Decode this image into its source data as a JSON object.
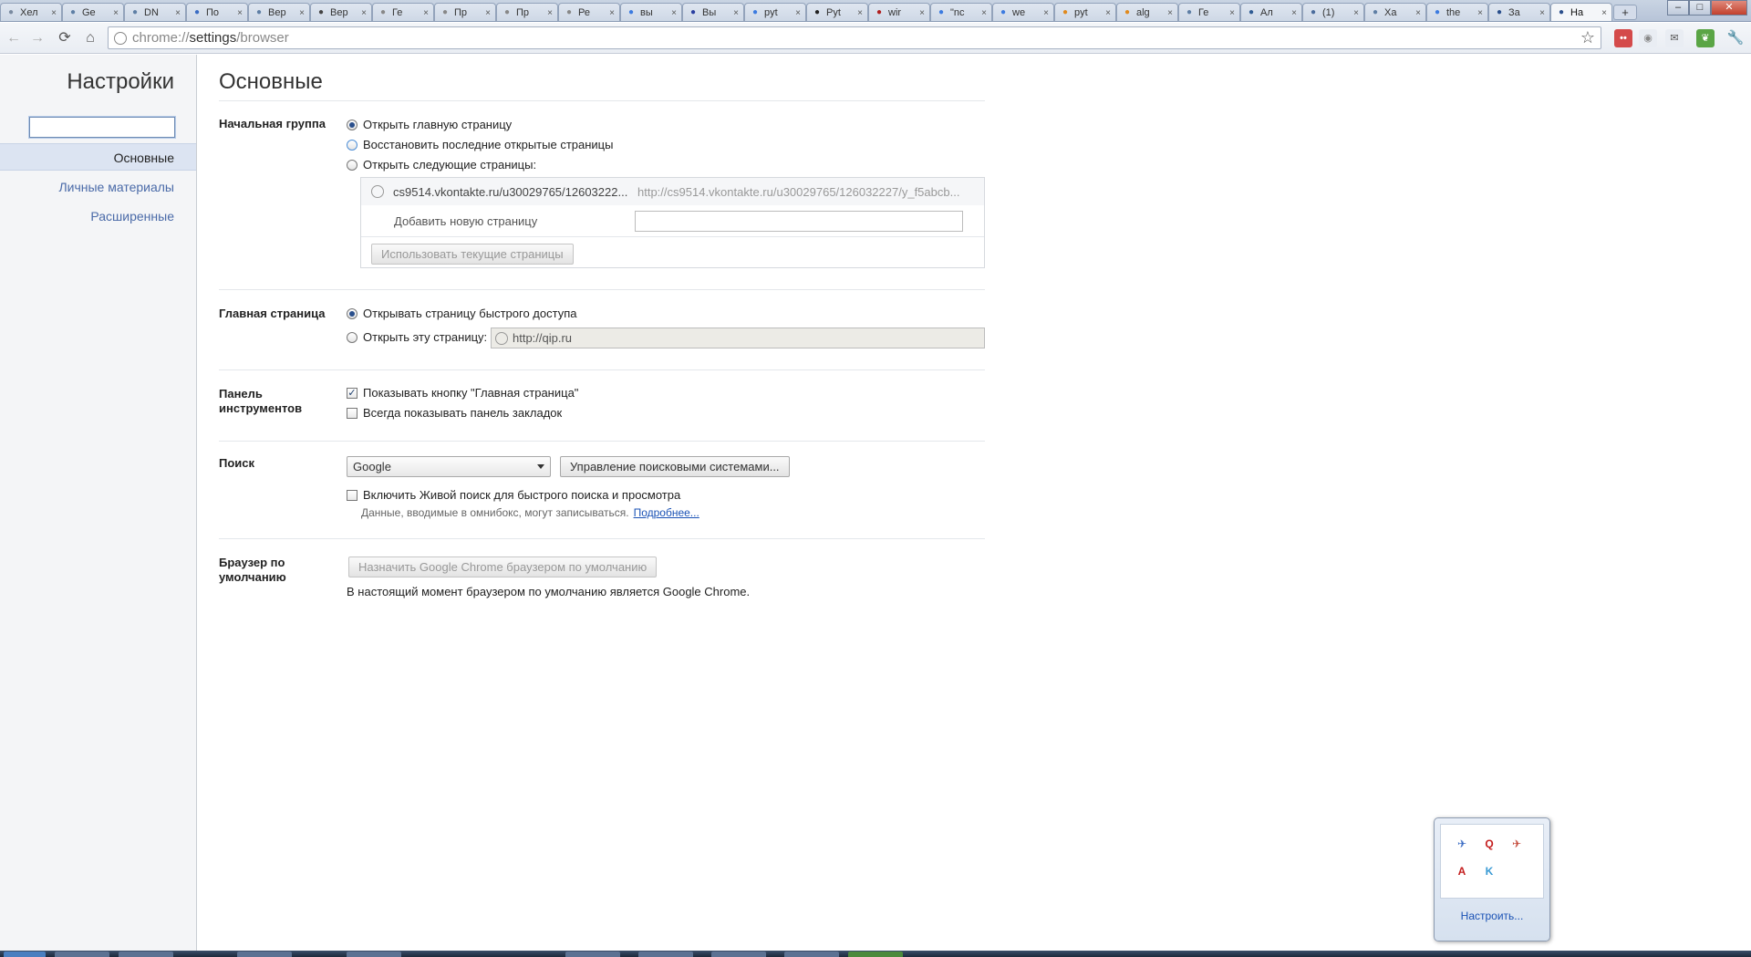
{
  "tabs": [
    {
      "label": "Хел",
      "icon": "document-icon",
      "color": "#7a8aa0"
    },
    {
      "label": "Ge",
      "icon": "habr-icon",
      "color": "#5f7fa5"
    },
    {
      "label": "DN",
      "icon": "habr-icon",
      "color": "#5f7fa5"
    },
    {
      "label": "По",
      "icon": "mail-icon",
      "color": "#3a6cc4"
    },
    {
      "label": "Вер",
      "icon": "habr-icon",
      "color": "#5f7fa5"
    },
    {
      "label": "Вер",
      "icon": "wikipedia-icon",
      "color": "#444444"
    },
    {
      "label": "Ге",
      "icon": "globe-icon",
      "color": "#888888"
    },
    {
      "label": "Пр",
      "icon": "globe-icon",
      "color": "#888888"
    },
    {
      "label": "Пр",
      "icon": "globe-icon",
      "color": "#888888"
    },
    {
      "label": "Ре",
      "icon": "globe-icon",
      "color": "#888888"
    },
    {
      "label": "вы",
      "icon": "google-icon",
      "color": "#3c7be0"
    },
    {
      "label": "Вы",
      "icon": "flag-icon",
      "color": "#2a3fa0"
    },
    {
      "label": "pyt",
      "icon": "google-icon",
      "color": "#3c7be0"
    },
    {
      "label": "Pyt",
      "icon": "ch-icon",
      "color": "#222222"
    },
    {
      "label": "wir",
      "icon": "as-icon",
      "color": "#b01e1e"
    },
    {
      "label": "\"nc",
      "icon": "google-icon",
      "color": "#3c7be0"
    },
    {
      "label": "we",
      "icon": "google-icon",
      "color": "#3c7be0"
    },
    {
      "label": "pyt",
      "icon": "stackoverflow-icon",
      "color": "#e08a1e"
    },
    {
      "label": "alg",
      "icon": "stackoverflow-icon",
      "color": "#e08a1e"
    },
    {
      "label": "Ге",
      "icon": "habr-icon",
      "color": "#5f7fa5"
    },
    {
      "label": "Ал",
      "icon": "book-icon",
      "color": "#2f5b93"
    },
    {
      "label": "(1)",
      "icon": "vk-icon",
      "color": "#4b6c9c"
    },
    {
      "label": "Ха",
      "icon": "habr-icon",
      "color": "#5f7fa5"
    },
    {
      "label": "the",
      "icon": "google-icon",
      "color": "#3c7be0"
    },
    {
      "label": "За",
      "icon": "download-icon",
      "color": "#2a4f8c"
    },
    {
      "label": "На",
      "icon": "wrench-icon",
      "color": "#2a4f8c"
    }
  ],
  "window": {
    "minimize": "–",
    "maximize": "□",
    "close": "✕",
    "new_tab": "+"
  },
  "toolbar": {
    "url_prefix": "chrome://",
    "url_host": "settings",
    "url_path": "/browser",
    "back_glyph": "←",
    "forward_glyph": "→",
    "reload_glyph": "⟳",
    "home_glyph": "⌂",
    "star_glyph": "☆",
    "wrench_glyph": "🔧"
  },
  "extensions": [
    {
      "name": "lastpass-icon",
      "glyph": "••",
      "bg": "#d44a4a",
      "fg": "#ffffff"
    },
    {
      "name": "extension-gray-icon",
      "glyph": "◉",
      "bg": "#e9edf3",
      "fg": "#888888"
    },
    {
      "name": "gmail-checker-icon",
      "glyph": "✉",
      "bg": "#e9edf3",
      "fg": "#555555"
    },
    {
      "name": "evernote-icon",
      "glyph": "❦",
      "bg": "#5aa545",
      "fg": "#ffffff"
    }
  ],
  "sidebar": {
    "title": "Настройки",
    "search_value": "",
    "items": [
      {
        "label": "Основные",
        "selected": true
      },
      {
        "label": "Личные материалы",
        "selected": false
      },
      {
        "label": "Расширенные",
        "selected": false
      }
    ]
  },
  "main": {
    "title": "Основные",
    "startup": {
      "title": "Начальная группа",
      "options": [
        {
          "label": "Открыть главную страницу",
          "checked": true
        },
        {
          "label": "Восстановить последние открытые страницы",
          "checked": false
        },
        {
          "label": "Открыть следующие страницы:",
          "checked": false
        }
      ],
      "page_title": "cs9514.vkontakte.ru/u30029765/12603222...",
      "page_url": "http://cs9514.vkontakte.ru/u30029765/126032227/y_f5abcb...",
      "add_page_label": "Добавить новую страницу",
      "add_page_value": "",
      "use_current_button": "Использовать текущие страницы"
    },
    "homepage": {
      "title": "Главная страница",
      "options": [
        {
          "label": "Открывать страницу быстрого доступа",
          "checked": true
        },
        {
          "label": "Открыть эту страницу:",
          "checked": false
        }
      ],
      "url_value": "http://qip.ru"
    },
    "toolbar_section": {
      "title_line1": "Панель",
      "title_line2": "инструментов",
      "options": [
        {
          "label": "Показывать кнопку \"Главная страница\"",
          "checked": true
        },
        {
          "label": "Всегда показывать панель закладок",
          "checked": false
        }
      ]
    },
    "search": {
      "title": "Поиск",
      "engine": "Google",
      "manage_button": "Управление поисковыми системами...",
      "instant_label": "Включить Живой поиск для быстрого поиска и просмотра",
      "instant_checked": false,
      "note": "Данные, вводимые в омнибокс, могут записываться.",
      "more_link": "Подробнее..."
    },
    "default_browser": {
      "title_line1": "Браузер по",
      "title_line2": "умолчанию",
      "button": "Назначить Google Chrome браузером по умолчанию",
      "status": "В настоящий момент браузером по умолчанию является Google Chrome."
    }
  },
  "tray": {
    "icons": [
      {
        "name": "satellite-icon",
        "glyph": "✈",
        "color": "#3a6cc4"
      },
      {
        "name": "qip-icon",
        "glyph": "Q",
        "color": "#c41e1e"
      },
      {
        "name": "mosquito-icon",
        "glyph": "✈",
        "color": "#c44a3a"
      },
      {
        "name": "adobe-icon",
        "glyph": "A",
        "color": "#c41e1e"
      },
      {
        "name": "kaspersky-icon",
        "glyph": "K",
        "color": "#3a9ad4"
      }
    ],
    "customize": "Настроить..."
  }
}
